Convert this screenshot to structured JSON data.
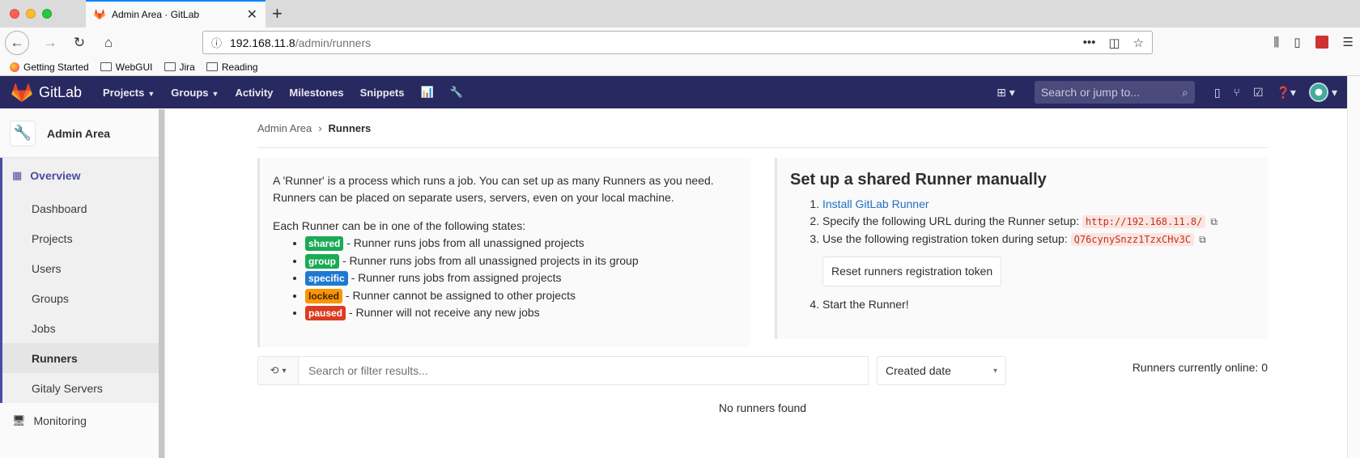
{
  "browser": {
    "tab_title": "Admin Area · GitLab",
    "url_host": "192.168.11.8",
    "url_path": "/admin/runners",
    "bookmarks": [
      "Getting Started",
      "WebGUI",
      "Jira",
      "Reading"
    ]
  },
  "gitlab": {
    "brand": "GitLab",
    "nav": [
      "Projects",
      "Groups",
      "Activity",
      "Milestones",
      "Snippets"
    ],
    "search_placeholder": "Search or jump to..."
  },
  "sidebar": {
    "title": "Admin Area",
    "overview": "Overview",
    "items": [
      "Dashboard",
      "Projects",
      "Users",
      "Groups",
      "Jobs",
      "Runners",
      "Gitaly Servers"
    ],
    "active": "Runners",
    "monitoring": "Monitoring"
  },
  "breadcrumb": {
    "parent": "Admin Area",
    "current": "Runners"
  },
  "intro": {
    "p1": "A 'Runner' is a process which runs a job. You can set up as many Runners as you need. Runners can be placed on separate users, servers, even on your local machine.",
    "p2": "Each Runner can be in one of the following states:",
    "states": [
      {
        "badge": "shared",
        "text": "- Runner runs jobs from all unassigned projects",
        "color": "#1aaa55"
      },
      {
        "badge": "group",
        "text": "- Runner runs jobs from all unassigned projects in its group",
        "color": "#1aaa55"
      },
      {
        "badge": "specific",
        "text": "- Runner runs jobs from assigned projects",
        "color": "#1f78d1"
      },
      {
        "badge": "locked",
        "text": "- Runner cannot be assigned to other projects",
        "color": "#fc9403"
      },
      {
        "badge": "paused",
        "text": "- Runner will not receive any new jobs",
        "color": "#db3b21"
      }
    ]
  },
  "setup": {
    "title": "Set up a shared Runner manually",
    "step1_link": "Install GitLab Runner",
    "step2": "Specify the following URL during the Runner setup:",
    "step2_code": "http://192.168.11.8/",
    "step3": "Use the following registration token during setup:",
    "step3_code": "Q76cynySnzz1TzxCHv3C",
    "reset_button": "Reset runners registration token",
    "step4": "Start the Runner!"
  },
  "filter": {
    "placeholder": "Search or filter results...",
    "sort": "Created date",
    "online": "Runners currently online: 0"
  },
  "empty": "No runners found"
}
